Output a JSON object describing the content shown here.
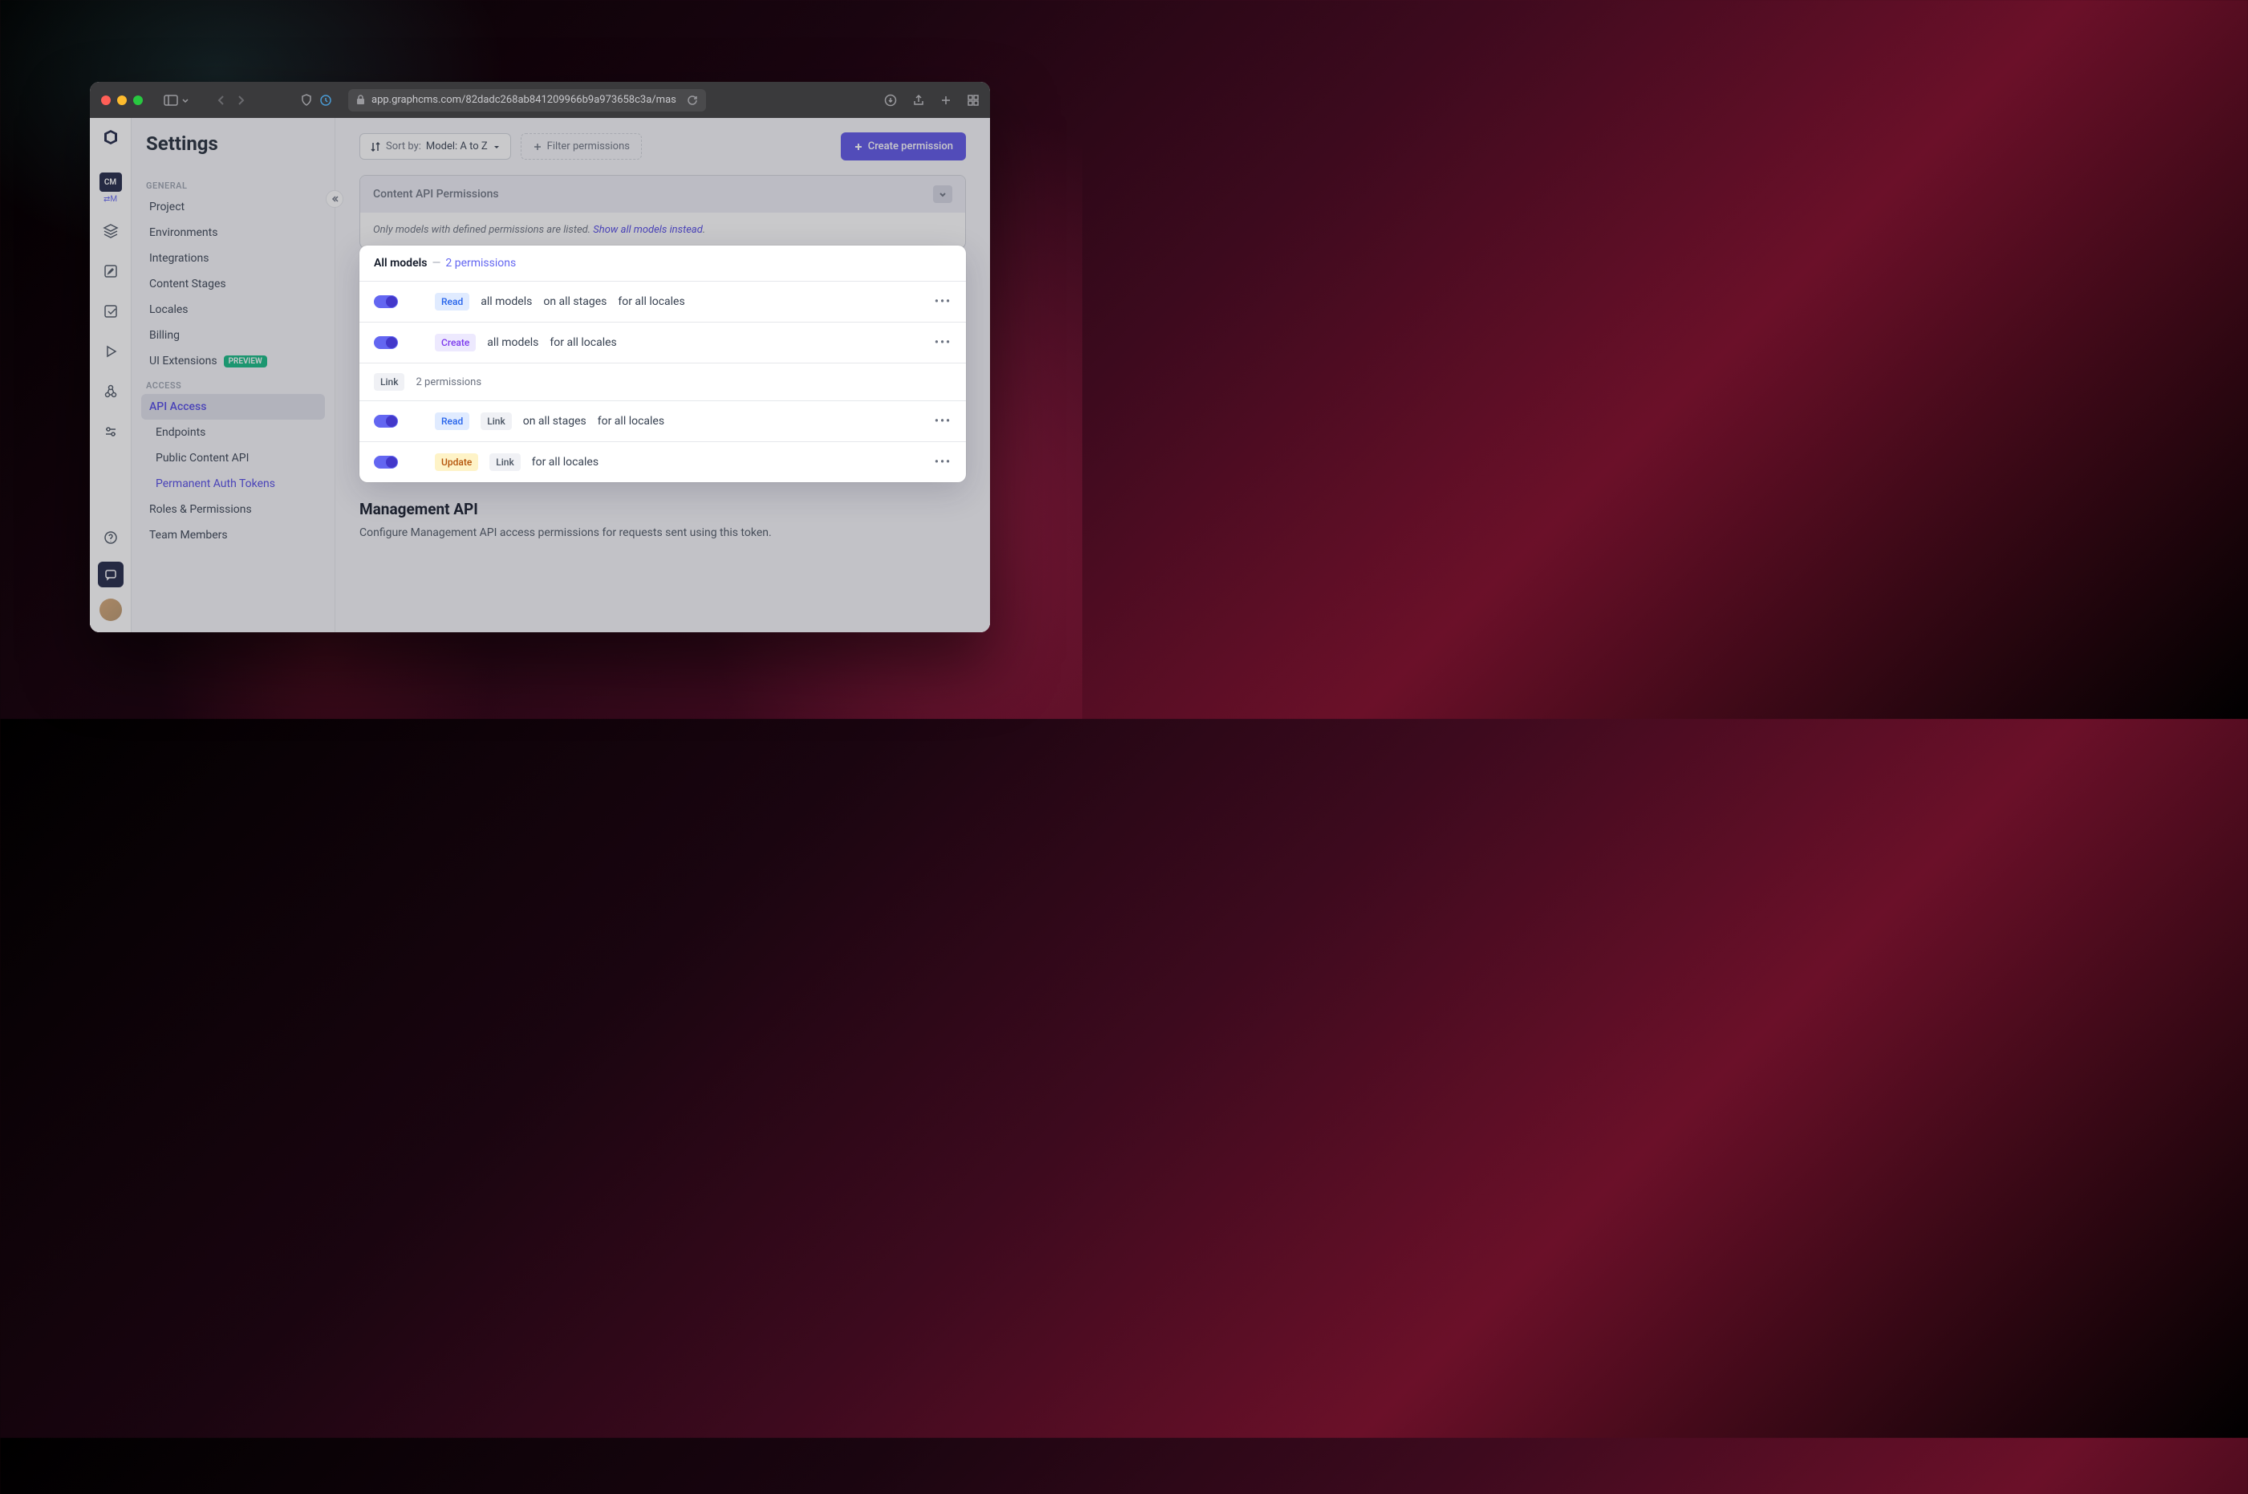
{
  "url": "app.graphcms.com/82dadc268ab841209966b9a973658c3a/mas",
  "iconrail": {
    "badge": "CM",
    "sub": "⇄M"
  },
  "sidebar": {
    "title": "Settings",
    "sections": {
      "general": {
        "label": "GENERAL",
        "items": [
          "Project",
          "Environments",
          "Integrations",
          "Content Stages",
          "Locales",
          "Billing"
        ],
        "ui_ext": "UI Extensions",
        "preview": "PREVIEW"
      },
      "access": {
        "label": "ACCESS",
        "api_access": "API Access",
        "endpoints": "Endpoints",
        "public": "Public Content API",
        "pat": "Permanent Auth Tokens",
        "roles": "Roles & Permissions",
        "team": "Team Members"
      }
    }
  },
  "toolbar": {
    "sort_prefix": "Sort by:",
    "sort_value": "Model: A to Z",
    "filter": "Filter permissions",
    "create": "Create permission"
  },
  "panel": {
    "header": "Content API Permissions",
    "note_prefix": "Only models with defined permissions are listed. ",
    "note_link": "Show all models instead",
    "note_suffix": "."
  },
  "card": {
    "all_models": "All models",
    "dash": "—",
    "perm_count": "2 permissions",
    "rows": [
      {
        "tag": "Read",
        "tag_class": "tag-read",
        "text": [
          "all models",
          "on all stages",
          "for all locales"
        ]
      },
      {
        "tag": "Create",
        "tag_class": "tag-create",
        "text": [
          "all models",
          "for all locales"
        ]
      }
    ],
    "group": {
      "label": "Link",
      "count": "2 permissions"
    },
    "group_rows": [
      {
        "tags": [
          {
            "t": "Read",
            "c": "tag-read"
          },
          {
            "t": "Link",
            "c": "tag-link"
          }
        ],
        "text": [
          "on all stages",
          "for all locales"
        ]
      },
      {
        "tags": [
          {
            "t": "Update",
            "c": "tag-update"
          },
          {
            "t": "Link",
            "c": "tag-link"
          }
        ],
        "text": [
          "for all locales"
        ]
      }
    ]
  },
  "mgmt": {
    "title": "Management API",
    "desc": "Configure Management API access permissions for requests sent using this token."
  }
}
